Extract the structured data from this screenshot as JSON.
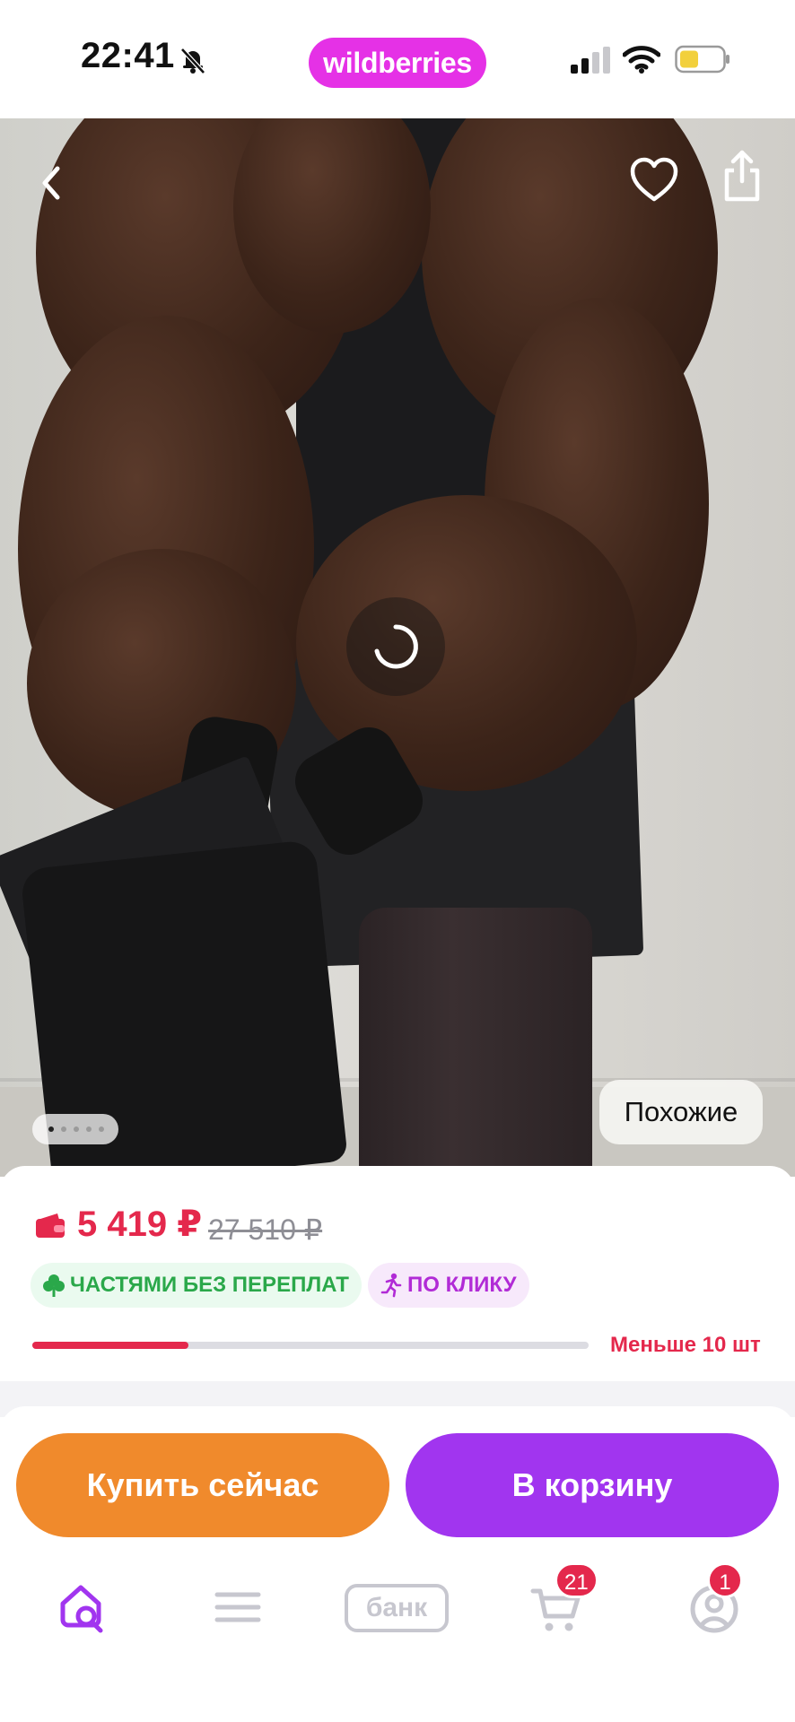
{
  "status_bar": {
    "time": "22:41",
    "brand": "wildberries",
    "brand_color": "#e531e6"
  },
  "product_image": {
    "description_icons": [
      "back-arrow-icon",
      "heart-icon",
      "share-icon",
      "loading-spinner-icon"
    ],
    "similar_label": "Похожие",
    "gallery": {
      "count": 5,
      "active_index": 0
    }
  },
  "price": {
    "current": "5 419 ₽",
    "old": "27 510 ₽",
    "color": "#e4284c"
  },
  "badges": {
    "installments": "ЧАСТЯМИ БЕЗ ПЕРЕПЛАТ",
    "one_click": "ПО КЛИКУ"
  },
  "stock": {
    "label": "Меньше 10 шт",
    "level_fraction": 0.28
  },
  "actions": {
    "buy_now": "Купить сейчас",
    "add_to_cart": "В корзину",
    "buy_color": "#f08a2c",
    "cart_color": "#a135ef"
  },
  "tabbar": {
    "bank_label": "банк",
    "cart_count": "21",
    "profile_count": "1",
    "active_tab": "home"
  }
}
